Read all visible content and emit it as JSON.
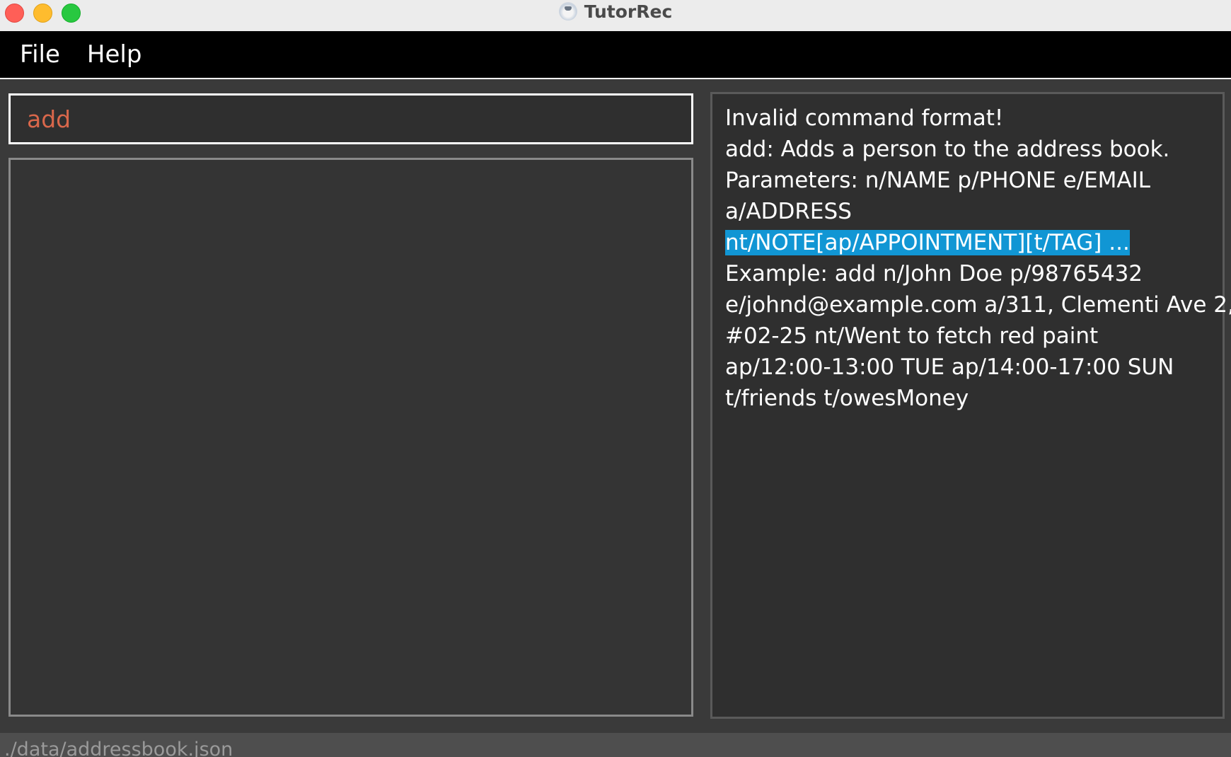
{
  "window": {
    "title": "TutorRec",
    "app_icon": "tutorrec-app-icon"
  },
  "menu": {
    "items": [
      "File",
      "Help"
    ]
  },
  "command": {
    "value": "add",
    "text_color": "#d9674b"
  },
  "result": {
    "lines": [
      "Invalid command format!",
      "add: Adds a person to the address book.",
      "Parameters: n/NAME p/PHONE e/EMAIL",
      "a/ADDRESS",
      "nt/NOTE[ap/APPOINTMENT][t/TAG] ...",
      "Example: add n/John Doe p/98765432",
      "e/johnd@example.com a/311, Clementi Ave 2,",
      "#02-25 nt/Went to fetch red paint",
      "ap/12:00-13:00 TUE ap/14:00-17:00 SUN",
      "t/friends t/owesMoney"
    ],
    "highlight_color": "#1196d4"
  },
  "status": {
    "file_path": "./data/addressbook.json"
  }
}
